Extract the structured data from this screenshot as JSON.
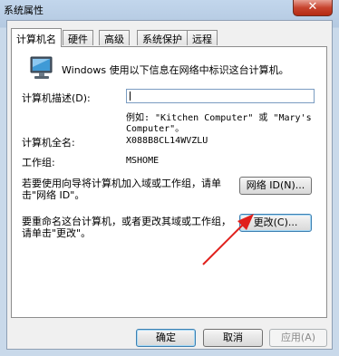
{
  "window": {
    "title": "系统属性",
    "close_glyph": "✕"
  },
  "tabs": [
    {
      "label": "计算机名",
      "active": true
    },
    {
      "label": "硬件",
      "active": false
    },
    {
      "label": "高级",
      "active": false
    },
    {
      "label": "系统保护",
      "active": false
    },
    {
      "label": "远程",
      "active": false
    }
  ],
  "content": {
    "intro": "Windows 使用以下信息在网络中标识这台计算机。",
    "description_label": "计算机描述(D):",
    "description_value": "",
    "example_line1": "例如: \"Kitchen Computer\" 或 \"Mary's",
    "example_line2": "Computer\"。",
    "fullname_label": "计算机全名:",
    "fullname_value": "X088B8CL14WVZLU",
    "workgroup_label": "工作组:",
    "workgroup_value": "MSHOME",
    "network_text_line1": "若要使用向导将计算机加入域或工作组，请单",
    "network_text_line2": "击\"网络 ID\"。",
    "network_button": "网络 ID(N)...",
    "change_text_line1": "要重命名这台计算机，或者更改其域或工作组，",
    "change_text_line2": "请单击\"更改\"。",
    "change_button": "更改(C)..."
  },
  "footer": {
    "ok": "确定",
    "cancel": "取消",
    "apply": "应用(A)"
  },
  "colors": {
    "arrow": "#e0201c",
    "accent_border": "#3c7fb1"
  }
}
